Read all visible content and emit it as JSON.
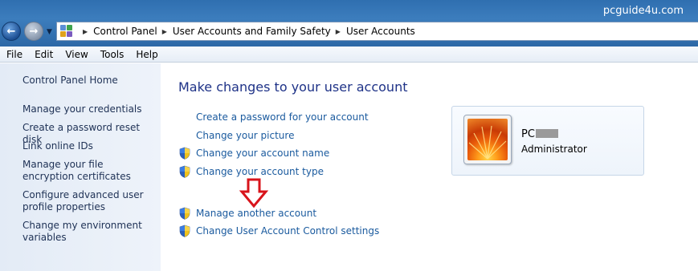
{
  "watermark": "pcguide4u.com",
  "breadcrumb": [
    "Control Panel",
    "User Accounts and Family Safety",
    "User Accounts"
  ],
  "menu": [
    "File",
    "Edit",
    "View",
    "Tools",
    "Help"
  ],
  "sidebar": {
    "items": [
      {
        "label": "Control Panel Home"
      },
      {
        "label": "Manage your credentials"
      },
      {
        "label": "Create a password reset disk"
      },
      {
        "label": "Link online IDs"
      },
      {
        "label": "Manage your file encryption certificates"
      },
      {
        "label": "Configure advanced user profile properties"
      },
      {
        "label": "Change my environment variables"
      }
    ]
  },
  "main": {
    "title": "Make changes to your user account",
    "tasks": [
      {
        "label": "Create a password for your account",
        "shield": false
      },
      {
        "label": "Change your picture",
        "shield": false
      },
      {
        "label": "Change your account name",
        "shield": true
      },
      {
        "label": "Change your account type",
        "shield": true
      },
      {
        "label": "Manage another account",
        "shield": true
      },
      {
        "label": "Change User Account Control settings",
        "shield": true
      }
    ]
  },
  "account": {
    "name_visible": "PC",
    "type": "Administrator"
  },
  "colors": {
    "link": "#1a5a9e",
    "title": "#1e3287",
    "arrow": "#d8141b"
  }
}
